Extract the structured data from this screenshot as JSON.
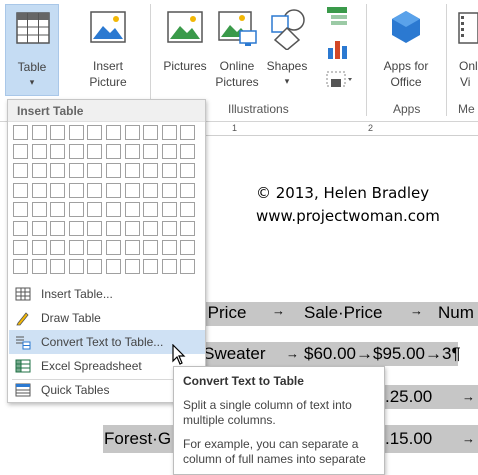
{
  "ribbon": {
    "table_label": "Table",
    "insert_picture_line1": "Insert",
    "insert_picture_line2": "Picture",
    "pictures_label": "Pictures",
    "online_pictures_line1": "Online",
    "online_pictures_line2": "Pictures",
    "shapes_label": "Shapes",
    "apps_for_office_line1": "Apps for",
    "apps_for_office_line2": "Office",
    "online_video_line1": "Onl",
    "online_video_line2": "Vi",
    "groups": {
      "illustrations": "Illustrations",
      "apps": "Apps",
      "media": "Me"
    }
  },
  "ruler": {
    "mark1": "1",
    "mark2": "2"
  },
  "document": {
    "copyright_line1": "© 2013, Helen Bradley",
    "copyright_line2": "www.projectwoman.com",
    "row1_col1": "·Price",
    "row1_col2": "Sale·Price",
    "row1_col3": "Num",
    "row2_col1": "e·Sweater",
    "row2_col2": "$60.00→$95.00→3¶",
    "row3_col1": ".25.00",
    "row4_col1": "Forest·G",
    "row4_col2": ".15.00",
    "tab_arrow": "→"
  },
  "dropdown": {
    "header": "Insert Table",
    "items": [
      {
        "label": "Insert Table...",
        "accel": "I"
      },
      {
        "label": "Draw Table",
        "accel": "D"
      },
      {
        "label": "Convert Text to Table...",
        "accel": "v"
      },
      {
        "label": "Excel Spreadsheet",
        "accel": "x"
      },
      {
        "label": "Quick Tables",
        "accel": "T"
      }
    ]
  },
  "tooltip": {
    "title": "Convert Text to Table",
    "body1": "Split a single column of text into multiple columns.",
    "body2": "For example, you can separate a column of full names into separate"
  },
  "colors": {
    "selected_button": "#c5dcf3",
    "menu_hover": "#cfe1f4",
    "shading": "#c6c6c6",
    "accent_blue": "#2b79d1"
  }
}
